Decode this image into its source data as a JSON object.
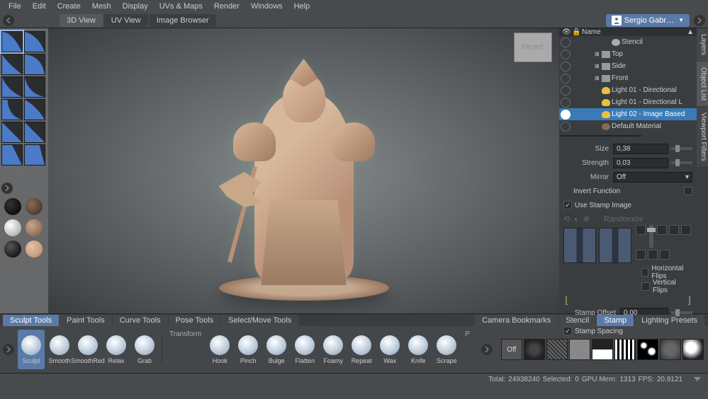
{
  "menu": [
    "File",
    "Edit",
    "Create",
    "Mesh",
    "Display",
    "UVs & Maps",
    "Render",
    "Windows",
    "Help"
  ],
  "view_tabs": [
    "3D View",
    "UV View",
    "Image Browser"
  ],
  "active_view_tab": 0,
  "user": "Sergio Gabr…",
  "navcube": "FRONT",
  "outliner": {
    "header": "Name",
    "items": [
      {
        "label": "Stencil",
        "indent": 3,
        "icon": "geo",
        "exp": ""
      },
      {
        "label": "Top",
        "indent": 2,
        "icon": "cam",
        "exp": "⊞"
      },
      {
        "label": "Side",
        "indent": 2,
        "icon": "cam",
        "exp": "⊞"
      },
      {
        "label": "Front",
        "indent": 2,
        "icon": "cam",
        "exp": "⊞"
      },
      {
        "label": "Light 01 - Directional",
        "indent": 2,
        "icon": "bulb",
        "exp": ""
      },
      {
        "label": "Light 01 - Directional L",
        "indent": 2,
        "icon": "bulb",
        "exp": ""
      },
      {
        "label": "Light 02 - Image Based",
        "indent": 2,
        "icon": "bulb",
        "exp": "",
        "selected": true
      },
      {
        "label": "Default Material",
        "indent": 2,
        "icon": "mat",
        "exp": ""
      }
    ]
  },
  "side_tabs": [
    "Layers",
    "Object List",
    "Viewport Filters"
  ],
  "props": {
    "size_label": "Size",
    "size": "0,38",
    "strength_label": "Strength",
    "strength": "0,03",
    "mirror_label": "Mirror",
    "mirror": "Off",
    "invert_label": "Invert Function",
    "use_stamp_label": "Use Stamp Image",
    "randomize_label": "Randomize",
    "hflip_label": "Horizontal Flips",
    "vflip_label": "Vertical Flips",
    "stamp_offset_label": "Stamp Offset",
    "stamp_offset": "0,00",
    "stamp_spacing_label": "Stamp Spacing"
  },
  "tool_tabs_left": [
    "Sculpt Tools",
    "Paint Tools",
    "Curve Tools",
    "Pose Tools",
    "Select/Move Tools"
  ],
  "tool_tabs_right": [
    "Camera Bookmarks",
    "Stencil",
    "Stamp",
    "Lighting Presets"
  ],
  "active_tool_tab": 0,
  "active_right_tab": 2,
  "tools_a": [
    "Sculpt",
    "Smooth",
    "SmoothRed",
    "Relax",
    "Grab"
  ],
  "tools_transform_label": "Transform",
  "tools_b": [
    "Hook",
    "Pinch",
    "Bulge",
    "Flatten",
    "Foamy",
    "Repeat",
    "Wax",
    "Knife",
    "Scrape"
  ],
  "tools_more": "P",
  "stamp_off": "Off",
  "status": {
    "total_label": "Total:",
    "total": "24938240",
    "selected_label": "Selected:",
    "selected": "0",
    "gpu_label": "GPU Mem:",
    "gpu": "1313",
    "fps_label": "FPS:",
    "fps": "20.9121"
  }
}
